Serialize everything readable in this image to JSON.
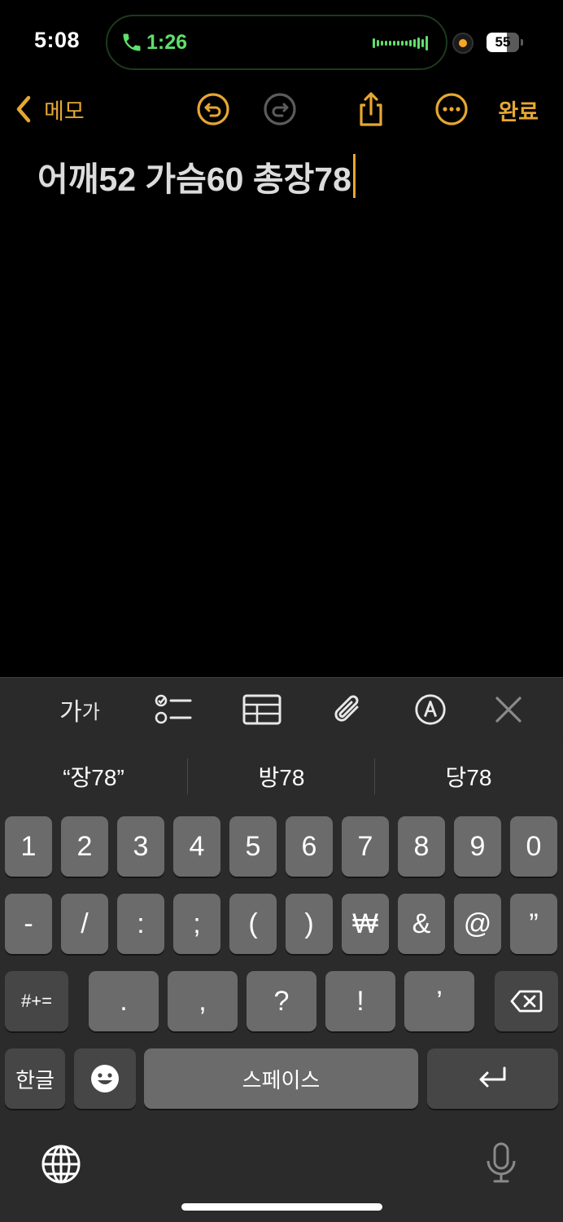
{
  "status": {
    "time": "5:08",
    "call_time": "1:26",
    "battery": "55"
  },
  "nav": {
    "back_label": "메모",
    "done_label": "완료",
    "accent": "#e6a732",
    "icons": [
      "undo-icon",
      "redo-icon",
      "share-icon",
      "more-icon"
    ]
  },
  "note": {
    "text": "어깨52 가슴60 총장78"
  },
  "format_toolbar": {
    "text_style_label_a": "가",
    "text_style_label_b": "가",
    "icons": [
      "checklist-icon",
      "table-icon",
      "attachment-icon",
      "markup-icon",
      "close-icon"
    ]
  },
  "keyboard": {
    "suggestions": [
      "“장78”",
      "방78",
      "당78"
    ],
    "row1": [
      "1",
      "2",
      "3",
      "4",
      "5",
      "6",
      "7",
      "8",
      "9",
      "0"
    ],
    "row2": [
      "-",
      "/",
      ":",
      ";",
      "(",
      ")",
      "₩",
      "&",
      "@",
      "”"
    ],
    "row3_left": "#+=",
    "row3": [
      ".",
      ",",
      "?",
      "!",
      "’"
    ],
    "lang_label": "한글",
    "space_label": "스페이스",
    "icons": [
      "delete-icon",
      "emoji-icon",
      "return-icon",
      "globe-icon",
      "microphone-icon"
    ]
  }
}
